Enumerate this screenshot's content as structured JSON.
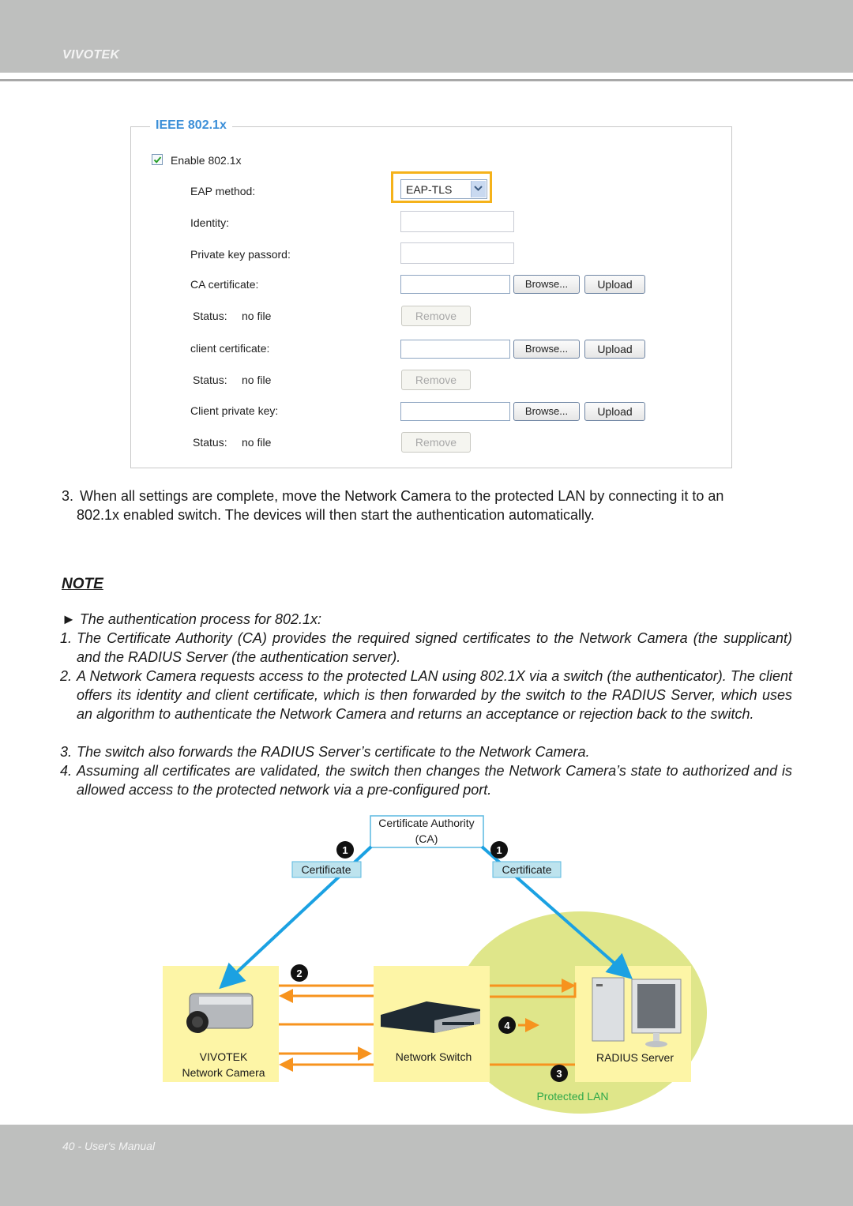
{
  "header": {
    "brand": "VIVOTEK"
  },
  "form": {
    "legend": "IEEE 802.1x",
    "enable_label": "Enable 802.1x",
    "enable_checked": true,
    "eap_label": "EAP method:",
    "eap_value": "EAP-TLS",
    "identity_label": "Identity:",
    "identity_value": "",
    "pkpass_label": "Private key passord:",
    "pkpass_value": "",
    "rows": [
      {
        "label": "CA certificate:",
        "status_label": "Status:",
        "status_value": "no file"
      },
      {
        "label": "client certificate:",
        "status_label": "Status:",
        "status_value": "no file"
      },
      {
        "label": "Client private key:",
        "status_label": "Status:",
        "status_value": "no file"
      }
    ],
    "browse_label": "Browse...",
    "upload_label": "Upload",
    "remove_label": "Remove"
  },
  "step3": {
    "number": "3.",
    "line1": "When all settings are complete, move the Network Camera to the protected LAN by connecting it to an",
    "line2": "802.1x enabled switch. The devices will then start the authentication automatically."
  },
  "note": {
    "title": "NOTE",
    "intro": "► The authentication process for 802.1x:",
    "items": [
      {
        "num": "1.",
        "text": "The Certificate Authority (CA) provides the required signed certificates to the Network Camera (the supplicant) and the RADIUS Server (the authentication server)."
      },
      {
        "num": "2.",
        "text": "A Network Camera requests access to the protected LAN using 802.1X via a switch (the authenticator). The client offers its identity and client certificate, which is then forwarded by the switch to the RADIUS Server, which uses an algorithm to authenticate the Network Camera and returns an acceptance or rejection back to the switch."
      },
      {
        "num": "3.",
        "text": "The switch also forwards the RADIUS Server’s certificate to the Network Camera."
      },
      {
        "num": "4.",
        "text": "Assuming all certificates are validated, the switch then changes the Network Camera’s state to authorized and is allowed access to the protected network via a pre-configured port."
      }
    ]
  },
  "diagram": {
    "ca_line1": "Certificate Authority",
    "ca_line2": "(CA)",
    "cert_left": "Certificate",
    "cert_right": "Certificate",
    "camera_line1": "VIVOTEK",
    "camera_line2": "Network Camera",
    "switch_label": "Network Switch",
    "server_label": "RADIUS Server",
    "lan_label": "Protected LAN",
    "badges": [
      "1",
      "1",
      "2",
      "3",
      "4"
    ],
    "colors": {
      "arrow_blue": "#1ba1e2",
      "arrow_orange": "#f7931e",
      "panel_yellow": "#fdf5a6",
      "lan_green": "#dfe68a",
      "lan_text": "#2ea84a"
    }
  },
  "footer": {
    "page": "40 - User's Manual"
  }
}
